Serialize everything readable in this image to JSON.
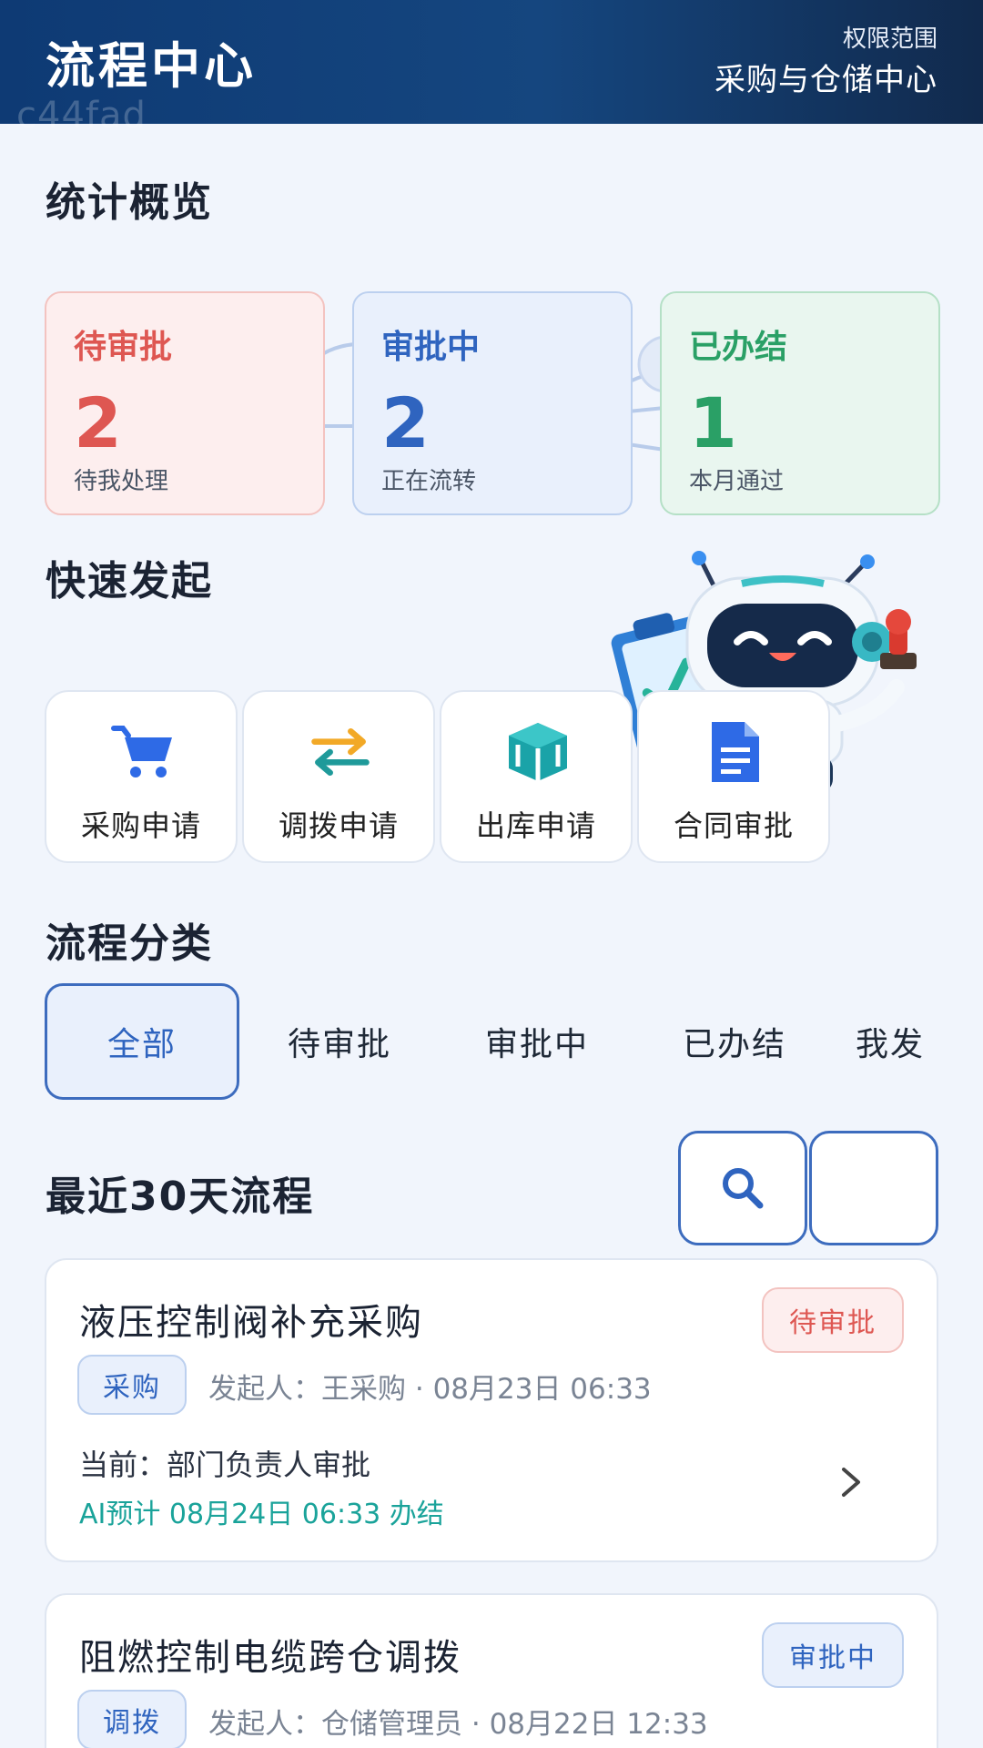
{
  "header": {
    "title": "流程中心",
    "watermark": "c44fad",
    "scope_label": "权限范围",
    "scope_value": "采购与仓储中心"
  },
  "stats": {
    "title": "统计概览",
    "items": [
      {
        "label": "待审批",
        "count": "2",
        "sub": "待我处理",
        "color": "#de5752"
      },
      {
        "label": "审批中",
        "count": "2",
        "sub": "正在流转",
        "color": "#2f64bf"
      },
      {
        "label": "已办结",
        "count": "1",
        "sub": "本月通过",
        "color": "#2aa066"
      }
    ]
  },
  "quick_actions": {
    "title": "快速发起",
    "items": [
      {
        "label": "采购申请",
        "icon": "cart-icon"
      },
      {
        "label": "调拨申请",
        "icon": "transfer-arrows-icon"
      },
      {
        "label": "出库申请",
        "icon": "box-icon"
      },
      {
        "label": "合同审批",
        "icon": "document-icon"
      }
    ]
  },
  "categories": {
    "title": "流程分类",
    "tabs": [
      {
        "label": "全部",
        "active": true
      },
      {
        "label": "待审批",
        "active": false
      },
      {
        "label": "审批中",
        "active": false
      },
      {
        "label": "已办结",
        "active": false
      },
      {
        "label": "我发",
        "active": false
      }
    ]
  },
  "recent": {
    "title": "最近30天流程",
    "items": [
      {
        "name": "液压控制阀补充采购",
        "status": "待审批",
        "category": "采购",
        "initiator_label": "发起人：",
        "initiator": "王采购",
        "date": "08月23日 06:33",
        "current_label": "当前：",
        "current": "部门负责人审批",
        "ai_estimate": "AI预计 08月24日 06:33 办结"
      },
      {
        "name": "阻燃控制电缆跨仓调拨",
        "status": "审批中",
        "category": "调拨",
        "initiator_label": "发起人：",
        "initiator": "仓储管理员",
        "date": "08月22日 12:33"
      }
    ]
  },
  "colors": {
    "brand": "#15467f",
    "accent": "#2f64bf",
    "pending": "#de5752",
    "done": "#2aa066",
    "ai": "#1aa39a"
  }
}
